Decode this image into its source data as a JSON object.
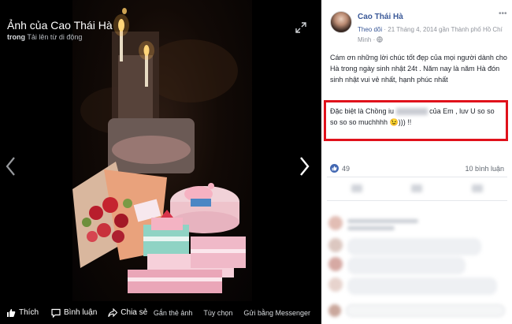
{
  "viewer": {
    "title": "Ảnh của Cao Thái Hà",
    "subtitle_prefix": "trong",
    "subtitle_album": "Tải lên từ di động",
    "actions": {
      "like": "Thích",
      "comment": "Bình luận",
      "share": "Chia sẻ"
    },
    "right_actions": {
      "tag": "Gắn thẻ ảnh",
      "options": "Tùy chọn",
      "messenger": "Gửi bằng Messenger"
    },
    "photo_alt": "Birthday cake with candles, flowers and gift boxes"
  },
  "post": {
    "author": "Cao Thái Hà",
    "follow": "Theo dõi",
    "date_location": " · 21 Tháng 4, 2014 gần Thành phố Hồ Chí Minh · ",
    "caption": "Cám ơn những lời chúc tốt đẹp của mọi người dành cho Hà trong ngày sinh nhật 24t . Năm nay là năm Hà đón sinh nhật vui vẻ nhất, hạnh phúc nhất",
    "highlight_pre": "Đặc biệt là Chồng iu ",
    "highlight_post": " của Em , luv U so so so so so muchhhh 😉))) !!",
    "reactions_count": "49",
    "comments_count": "10 bình luận"
  },
  "colors": {
    "link": "#3b5998",
    "highlight_border": "#e0111b",
    "viewer_bg": "#000000"
  }
}
